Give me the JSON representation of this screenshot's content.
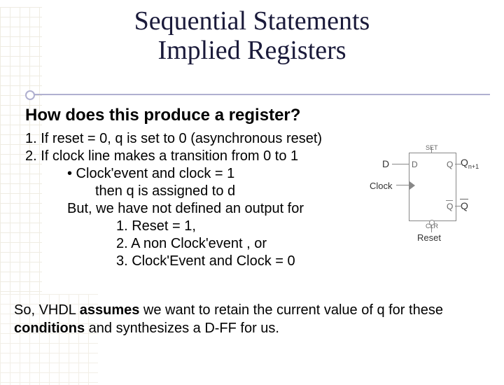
{
  "title": {
    "line1": "Sequential Statements",
    "line2": "Implied Registers"
  },
  "heading": "How does this produce a register?",
  "items": {
    "li1": "1.  If reset = 0,  q is set to 0  (asynchronous reset)",
    "li2": "2.  If clock line makes a transition from 0 to 1",
    "bullet": "•   Clock'event and clock = 1",
    "then": "then q is assigned to d",
    "but": "But, we have not defined an output for",
    "s1": "1.  Reset = 1,",
    "s2": "2.  A non Clock'event , or",
    "s3": "3.  Clock'Event and Clock = 0"
  },
  "diagram": {
    "set": "SET",
    "clr": "CLR",
    "d_port": "D",
    "d_sig": "D",
    "q_top": "Q",
    "qn": "n+1",
    "q_bot": "Q",
    "clock": "Clock",
    "reset": "Reset"
  },
  "footer": {
    "pre": "So, VHDL ",
    "bold1": "assumes",
    "mid": " we want to retain the current value of q for these ",
    "bold2": "conditions",
    "post": " and synthesizes a D-FF for us."
  }
}
